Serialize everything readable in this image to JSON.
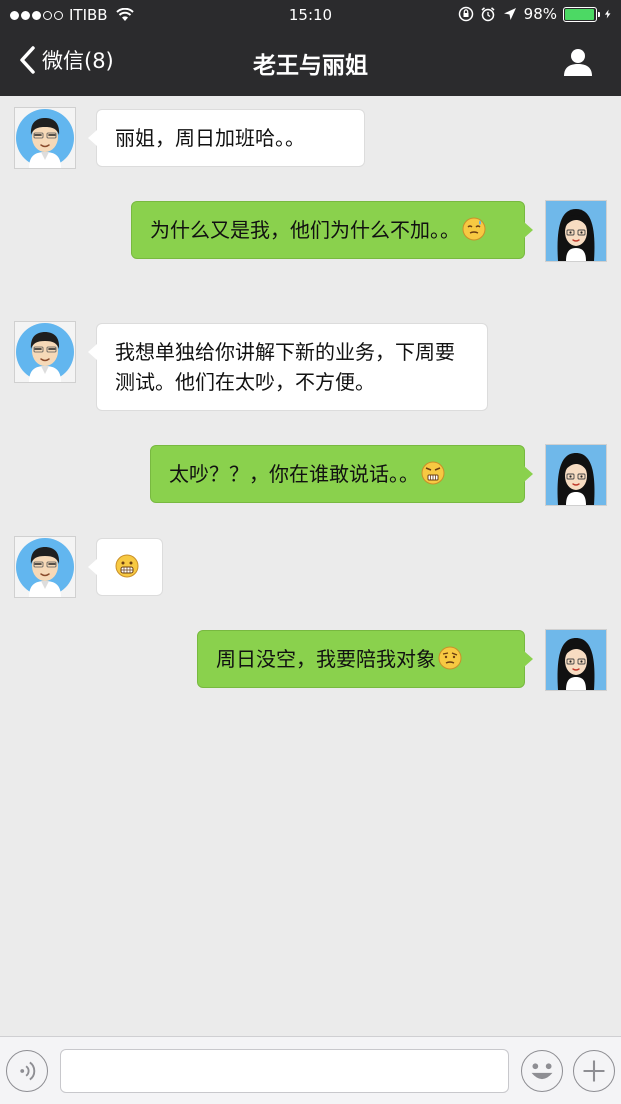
{
  "status_bar": {
    "carrier": "ITIBB",
    "time": "15:10",
    "battery": "98%",
    "battery_level": 0.98,
    "signal_bars": 3
  },
  "nav": {
    "back_label": "微信(8)",
    "title": "老王与丽姐"
  },
  "messages": [
    {
      "side": "in",
      "sender": "老王",
      "text": "丽姐，周日加班哈。。"
    },
    {
      "side": "out",
      "sender": "丽姐",
      "text": "为什么又是我，他们为什么不加。。",
      "emoji": "sweat-emoji"
    },
    {
      "side": "in",
      "sender": "老王",
      "text": "我想单独给你讲解下新的业务，下周要测试。他们在太吵，不方便。"
    },
    {
      "side": "out",
      "sender": "丽姐",
      "text": "太吵？？，你在谁敢说话。。",
      "emoji": "angry-emoji"
    },
    {
      "side": "in",
      "sender": "老王",
      "text": "",
      "emoji": "grin-emoji"
    },
    {
      "side": "out",
      "sender": "丽姐",
      "text": "周日没空，我要陪我对象",
      "emoji": "skeptical-emoji"
    }
  ],
  "input": {
    "value": "",
    "placeholder": ""
  },
  "colors": {
    "nav_bg": "#2b2b2d",
    "out_bubble": "#8ad14d",
    "in_bubble": "#ffffff",
    "chat_bg": "#ebebeb"
  }
}
